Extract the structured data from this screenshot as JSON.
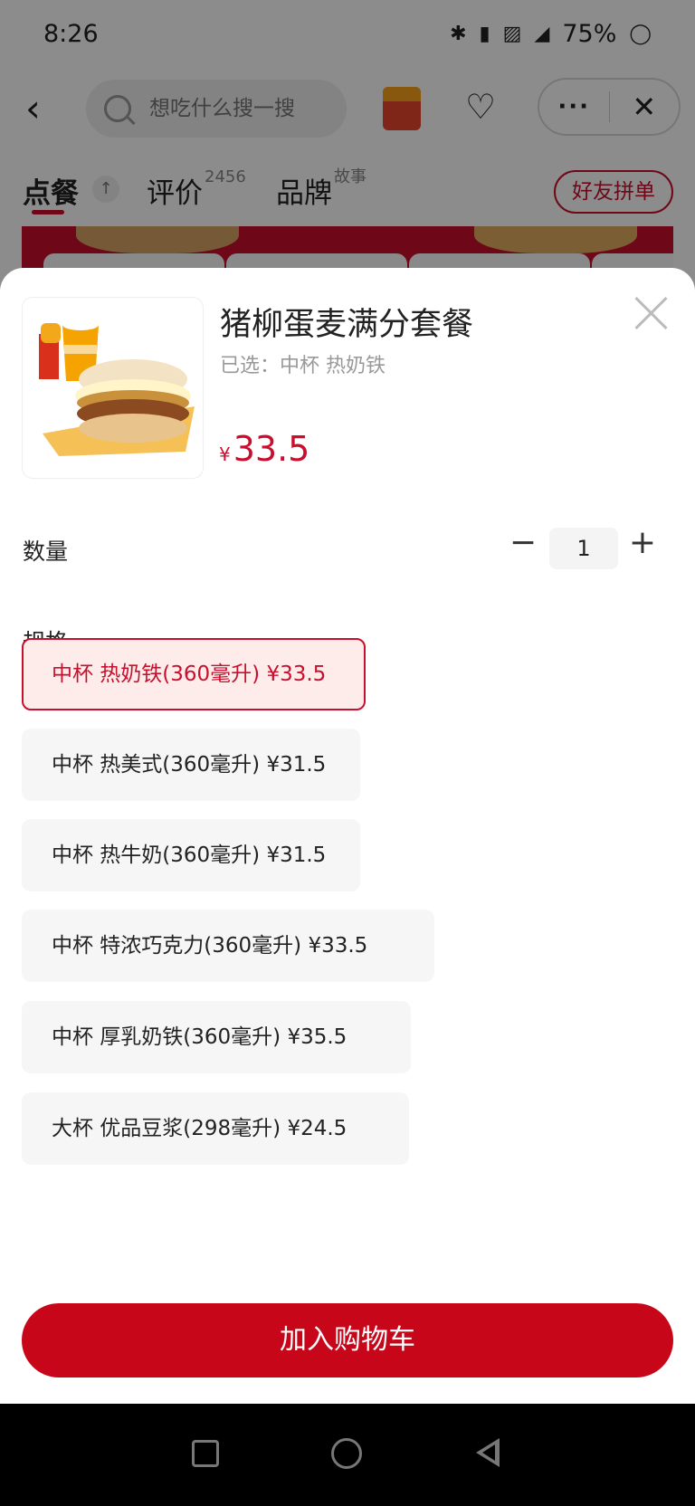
{
  "status_bar": {
    "time": "8:26",
    "battery": "75%",
    "network": "4G"
  },
  "header": {
    "search_placeholder": "想吃什么搜一搜",
    "back_icon": "chevron-left-icon",
    "more_label": "···",
    "close_label": "✕"
  },
  "tabs": {
    "order": "点餐",
    "review": "评价",
    "review_count": "2456",
    "brand": "品牌",
    "brand_sup": "故事",
    "friend_order": "好友拼单"
  },
  "product": {
    "title": "猪柳蛋麦满分套餐",
    "selected": "已选：中杯 热奶铁",
    "currency": "¥",
    "price": "33.5"
  },
  "quantity": {
    "label": "数量",
    "value": "1",
    "minus": "−",
    "plus": "+"
  },
  "spec": {
    "label": "规格",
    "options": [
      {
        "label": "中杯 热奶铁(360毫升)  ¥33.5",
        "selected": true
      },
      {
        "label": "中杯 热美式(360毫升)  ¥31.5",
        "selected": false
      },
      {
        "label": "中杯 热牛奶(360毫升)  ¥31.5",
        "selected": false
      },
      {
        "label": "中杯 特浓巧克力(360毫升)  ¥33.5",
        "selected": false
      },
      {
        "label": "中杯 厚乳奶铁(360毫升)  ¥35.5",
        "selected": false
      },
      {
        "label": "大杯 优品豆浆(298毫升)  ¥24.5",
        "selected": false
      }
    ]
  },
  "add_to_cart": "加入购物车",
  "colors": {
    "accent": "#c8102e",
    "button": "#c8061a"
  }
}
